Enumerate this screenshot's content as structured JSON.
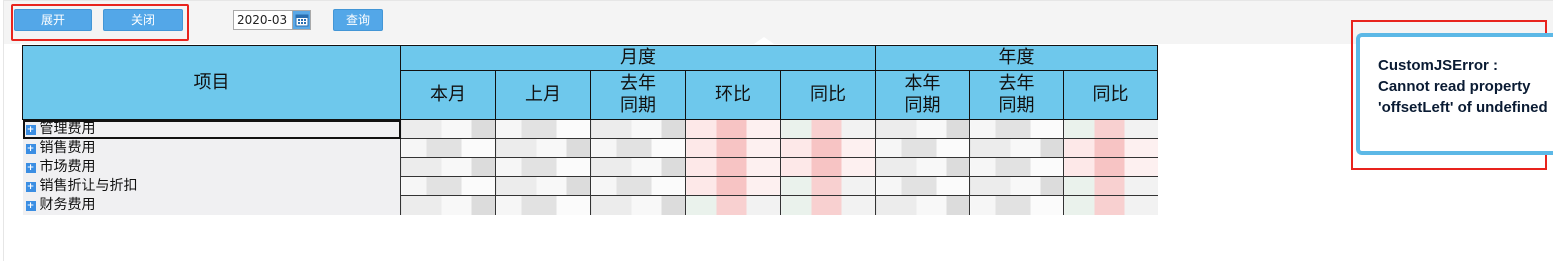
{
  "toolbar": {
    "expand_label": "展开",
    "collapse_label": "关闭",
    "date_value": "2020-03",
    "query_label": "查询"
  },
  "table": {
    "item_header": "项目",
    "monthly_header": "月度",
    "yearly_header": "年度",
    "monthly_columns": [
      "本月",
      "上月",
      "去年\n同期",
      "环比",
      "同比"
    ],
    "yearly_columns": [
      "本年\n同期",
      "去年\n同期",
      "同比"
    ],
    "rows": [
      "管理费用",
      "销售费用",
      "市场费用",
      "销售折让与折扣",
      "财务费用"
    ]
  },
  "error": {
    "message": "CustomJSError : Cannot read property 'offsetLeft' of undefined"
  },
  "colors": {
    "header_bg": "#6ec8ec",
    "button_bg": "#53a7e8",
    "highlight_red": "#e8231d",
    "error_border": "#5cb8e6"
  },
  "icons": [
    "calendar-icon",
    "plus-icon"
  ]
}
